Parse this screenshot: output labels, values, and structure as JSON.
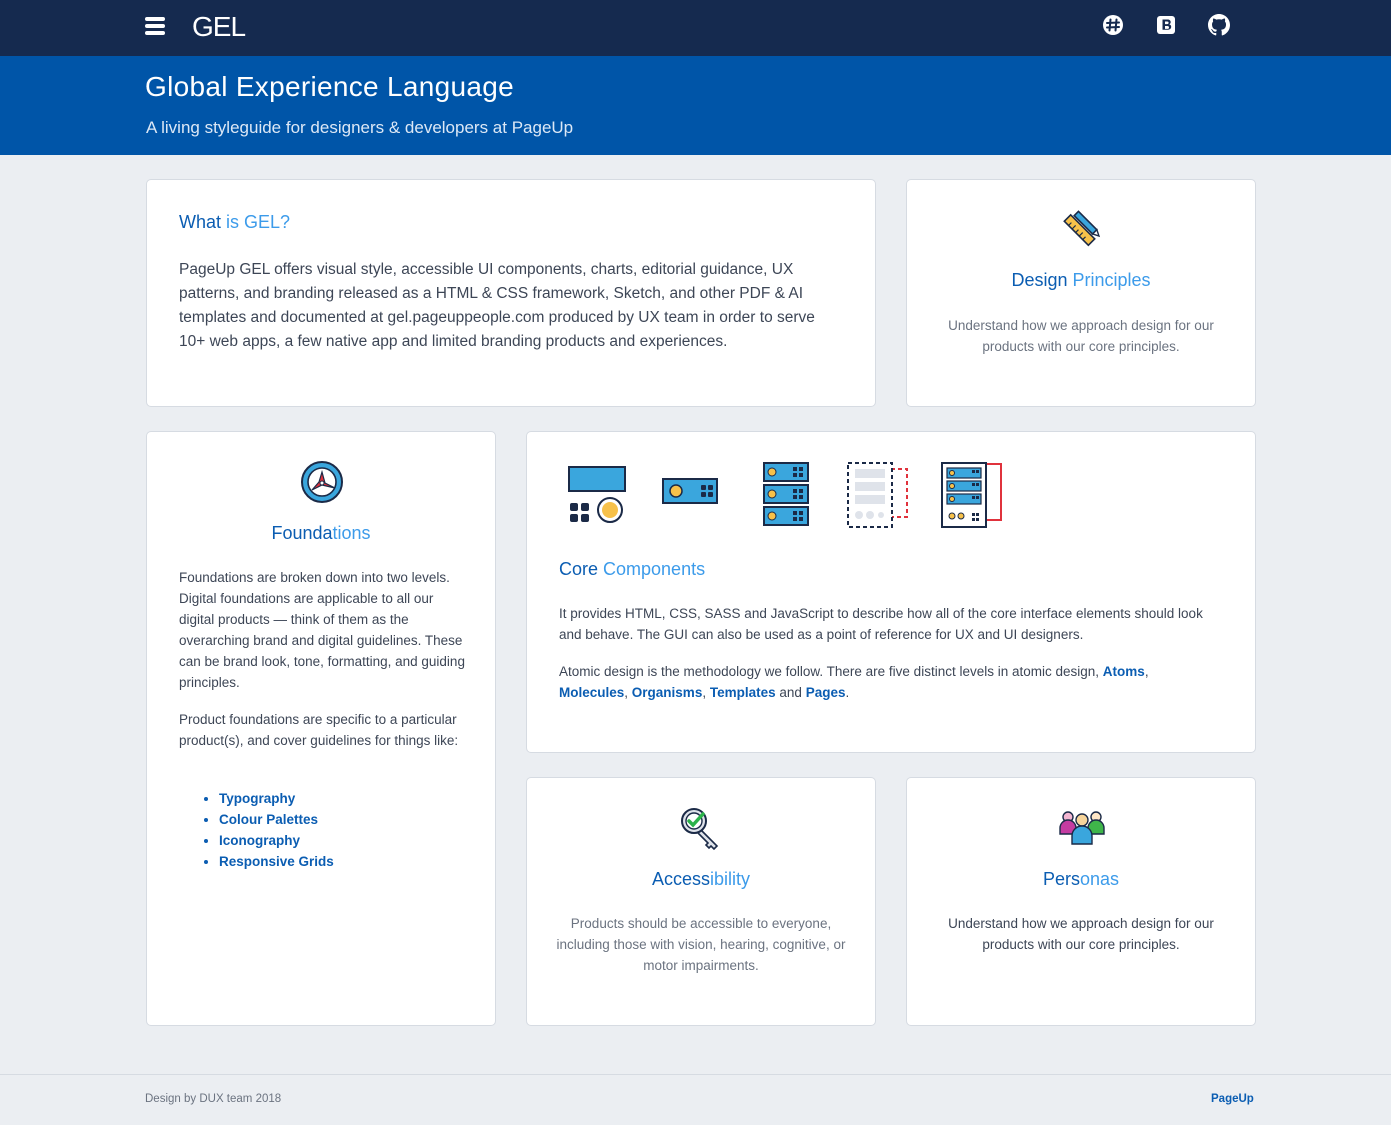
{
  "header": {
    "logo": "GEL",
    "icons": [
      "slack-icon",
      "bootstrap-icon",
      "github-icon"
    ]
  },
  "hero": {
    "title": "Global Experience Language",
    "subtitle": "A living styleguide for designers & developers at PageUp"
  },
  "what_is_gel": {
    "title_a": "What ",
    "title_b": "is GEL?",
    "body": "PageUp GEL offers visual style, accessible UI components, charts, editorial guidance, UX patterns, and branding released as a HTML & CSS framework, Sketch, and other PDF & AI templates and documented at gel.pageuppeople.com produced by UX team in order to serve 10+ web apps, a few native app and limited branding products and experiences."
  },
  "design_principles": {
    "title_a": "Design ",
    "title_b": "Principles",
    "body": "Understand how we approach design for our products with our core principles."
  },
  "foundations": {
    "title_a": "Founda",
    "title_b": "tions",
    "para1": "Foundations are broken down into two levels. Digital foundations are applicable to all our digital products — think of them as the overarching brand and digital guidelines. These can be brand look, tone, formatting, and guiding principles.",
    "para2": "Product foundations are specific to a particular product(s), and cover guidelines for things like:",
    "links": [
      "Typography",
      "Colour Palettes",
      "Iconography",
      "Responsive Grids"
    ]
  },
  "core_components": {
    "title_a": "Core ",
    "title_b": "Components",
    "para1": "It provides HTML, CSS, SASS and JavaScript to describe how all of the core interface elements should look and behave. The GUI can also be used as a point of reference for UX and UI designers.",
    "para2_lead": "Atomic design is the methodology we follow. There are five distinct levels in atomic design,",
    "link_atoms": "Atoms",
    "link_molecules": "Molecules",
    "link_organisms": "Organisms",
    "link_templates": "Templates",
    "and_text": "and",
    "link_pages": "Pages",
    "icons": [
      "atoms-icon",
      "molecules-icon",
      "organisms-icon",
      "templates-icon",
      "pages-icon"
    ]
  },
  "accessibility": {
    "title_a": "Access",
    "title_b": "ibility",
    "body": "Products should be accessible to everyone, including those with vision, hearing, cognitive, or motor impairments."
  },
  "personas": {
    "title_a": "Pers",
    "title_b": "onas",
    "body": "Understand how we approach design for our products with our core principles."
  },
  "footer": {
    "credit": "Design by DUX team 2018",
    "brand": "PageUp"
  },
  "colors": {
    "topbar": "#152a4f",
    "hero": "#0055a8",
    "accent": "#0b5db2",
    "accent_light": "#3c9bea",
    "background": "#ebeef2"
  }
}
